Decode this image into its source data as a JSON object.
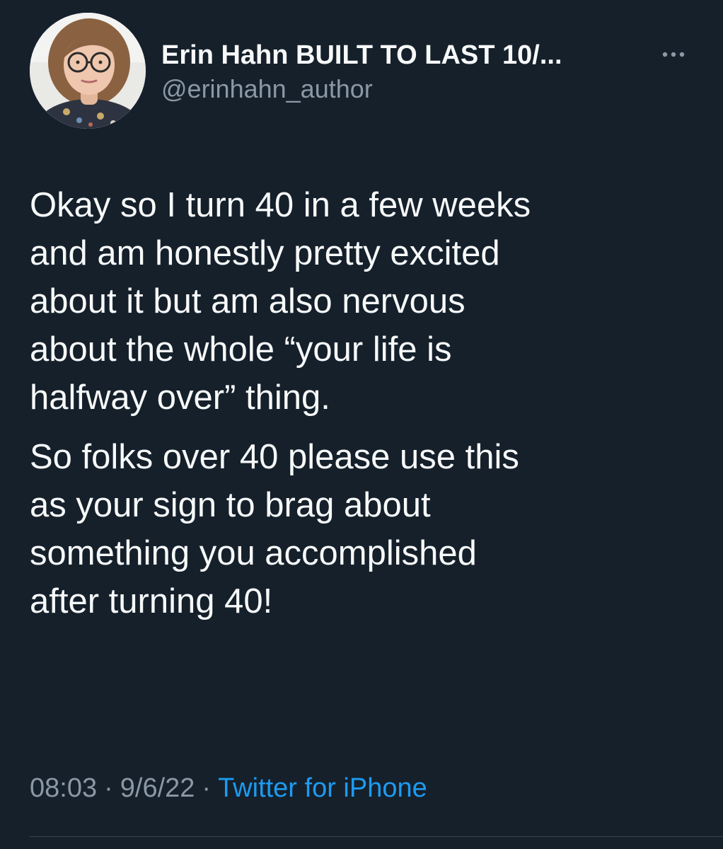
{
  "tweet": {
    "author": {
      "display_name": "Erin Hahn BUILT TO LAST 10/...",
      "handle": "@erinhahn_author",
      "avatar_icon": "profile-photo"
    },
    "more_icon": "ellipsis-icon",
    "paragraphs": [
      "Okay so I turn 40 in a few weeks\nand am honestly pretty excited\nabout it but am also nervous\nabout the whole “your life is\nhalfway over” thing.",
      "So folks over 40 please use this\nas your sign to brag about\nsomething you accomplished\nafter turning 40!"
    ],
    "time": "08:03",
    "separator": "·",
    "date": "9/6/22",
    "source": "Twitter for iPhone"
  },
  "colors": {
    "background": "#15202b",
    "text": "#f7f9f9",
    "secondary_text": "#8b98a5",
    "link": "#1d9bf0"
  }
}
